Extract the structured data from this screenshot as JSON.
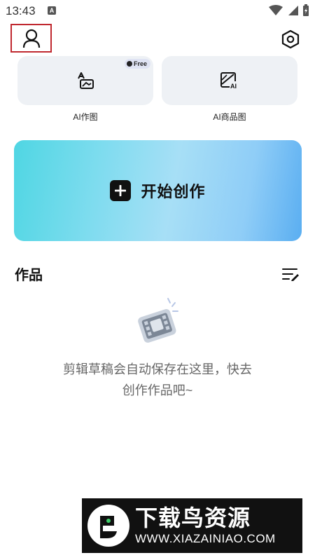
{
  "status_bar": {
    "time": "13:43",
    "notification_letter": "A"
  },
  "tools": [
    {
      "label": "AI作图",
      "badge": "Free",
      "icon": "ai-draw-icon"
    },
    {
      "label": "AI商品图",
      "icon": "ai-product-image-icon"
    }
  ],
  "create_button": {
    "label": "开始创作"
  },
  "works": {
    "title": "作品"
  },
  "empty_state": {
    "line1": "剪辑草稿会自动保存在这里，快去",
    "line2": "创作作品吧~"
  },
  "watermark": {
    "title": "下载鸟资源",
    "url": "WWW.XIAZAINIAO.COM"
  },
  "colors": {
    "card_bg": "#eef1f5",
    "accent_cyan": "#4fd6e3",
    "accent_blue": "#5aaef1",
    "profile_highlight": "#c0282f"
  }
}
